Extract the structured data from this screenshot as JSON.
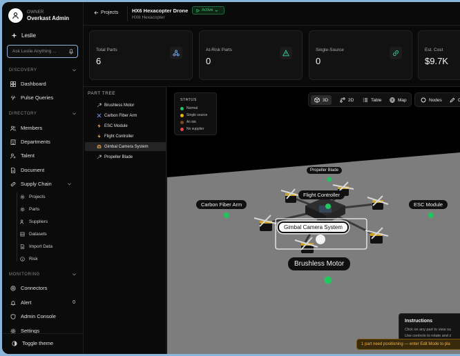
{
  "sidebar": {
    "owner_role": "OWNER",
    "owner_name": "Overkast Admin",
    "assistant_name": "Leslie",
    "ask_placeholder": "Ask Leslie Anything ...",
    "discovery_label": "DISCOVERY",
    "discovery_items": [
      "Dashboard",
      "Pulse Queries"
    ],
    "directory_label": "DIRECTORY",
    "directory_items": [
      "Members",
      "Departments",
      "Talent",
      "Document",
      "Supply Chain"
    ],
    "supply_chain_items": [
      "Projects",
      "Parts",
      "Suppliers",
      "Datasets",
      "Import Data",
      "Risk"
    ],
    "monitoring_label": "MONITORING",
    "monitoring_items": [
      "Connectors",
      "Alert",
      "Admin Console",
      "Settings"
    ],
    "alert_count": "0",
    "toggle_theme": "Toggle theme"
  },
  "header": {
    "back_label": "Projects",
    "project_title": "HX6 Hexacopter Drone",
    "project_subtitle": "HX6 Hexacopter",
    "status": "Active"
  },
  "stats": [
    {
      "label": "Total Parts",
      "value": "6",
      "icon": "cube-network-icon"
    },
    {
      "label": "At-Risk Parts",
      "value": "0",
      "icon": "warning-icon"
    },
    {
      "label": "Single-Source",
      "value": "0",
      "icon": "link-icon"
    },
    {
      "label": "Est. Cost",
      "value": "$9.7K"
    }
  ],
  "part_tree": {
    "title": "PART TREE",
    "items": [
      "Brushless Motor",
      "Carbon Fiber Arm",
      "ESC Module",
      "Flight Controller",
      "Gimbal Camera System",
      "Propeller Blade"
    ],
    "selected": "Gimbal Camera System"
  },
  "legend": {
    "title": "STATUS",
    "items": [
      {
        "label": "Normal",
        "color": "#22c55e"
      },
      {
        "label": "Single source",
        "color": "#eab308"
      },
      {
        "label": "At risk",
        "color": "#7c4a1e"
      },
      {
        "label": "No supplier",
        "color": "#ef4444"
      }
    ]
  },
  "view_tools": [
    "3D",
    "2D",
    "Table",
    "Map"
  ],
  "view_active": "3D",
  "view_tools2": [
    "Nodes",
    "Cu"
  ],
  "scene_labels": {
    "propeller": "Propeller Blade",
    "flight": "Flight Controller",
    "carbon": "Carbon Fiber Arm",
    "esc": "ESC Module",
    "gimbal": "Gimbal Camera System",
    "motor": "Brushless Motor"
  },
  "instructions": {
    "title": "Instructions",
    "line1": "Click on any part to view su",
    "line2": "Use controls to rotate and z"
  },
  "warning": "1 part need positioning — enter Edit Mode to pla"
}
